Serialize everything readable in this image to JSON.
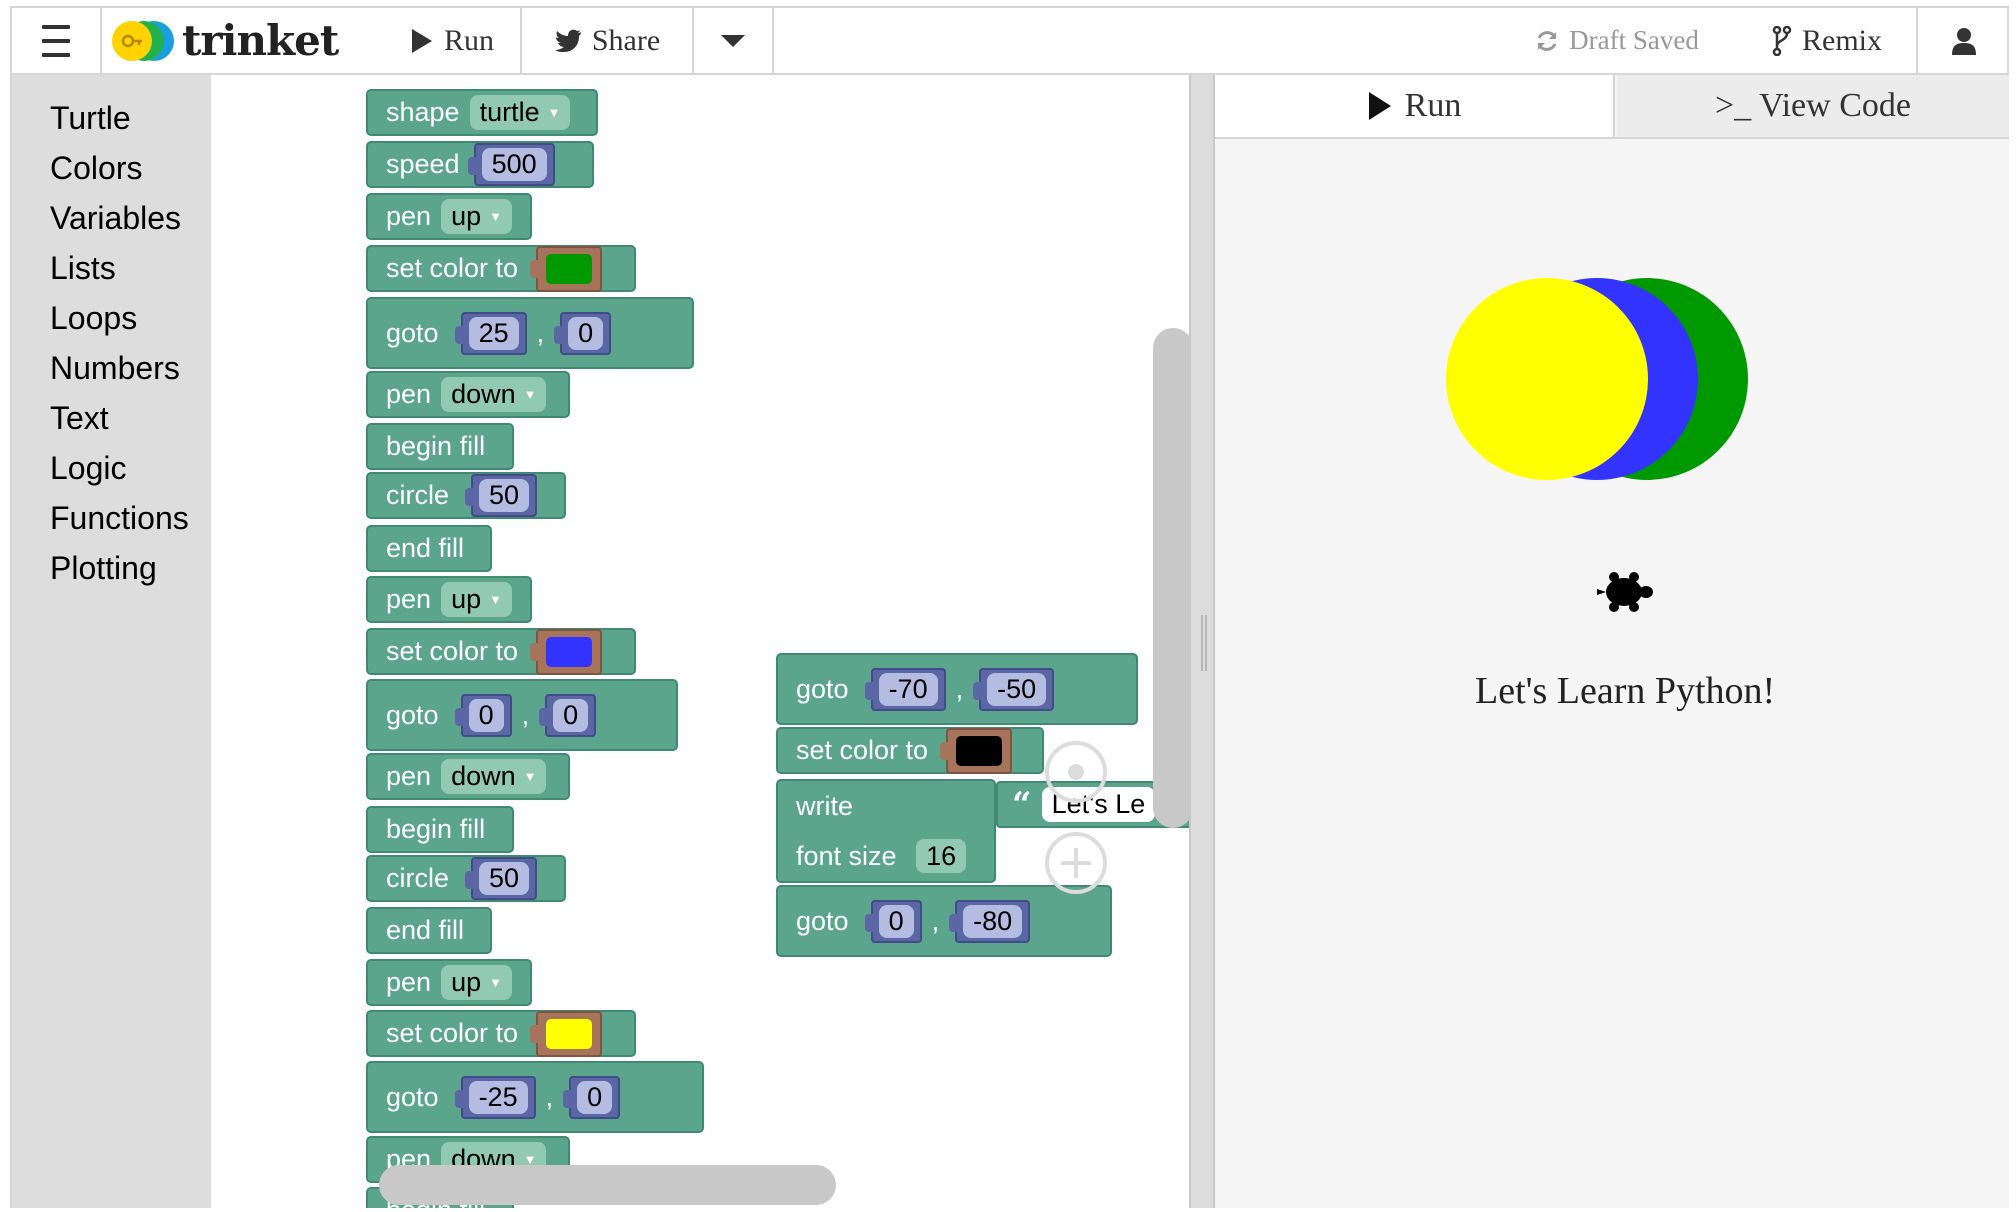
{
  "topbar": {
    "brand": "trinket",
    "run_label": "Run",
    "share_label": "Share",
    "status_label": "Draft Saved",
    "remix_label": "Remix"
  },
  "toolbox": {
    "categories": [
      "Turtle",
      "Colors",
      "Variables",
      "Lists",
      "Loops",
      "Numbers",
      "Text",
      "Logic",
      "Functions",
      "Plotting"
    ]
  },
  "blocks": {
    "shape_label": "shape",
    "shape_value": "turtle",
    "speed_label": "speed",
    "speed_value": "500",
    "pen_label": "pen",
    "up": "up",
    "down": "down",
    "set_color_label": "set color to",
    "goto_label": "goto",
    "comma": ",",
    "begin_fill_label": "begin fill",
    "circle_label": "circle",
    "circle_value": "50",
    "end_fill_label": "end fill",
    "goto1": [
      "25",
      "0"
    ],
    "goto2": [
      "0",
      "0"
    ],
    "goto3": [
      "-25",
      "0"
    ],
    "colors": [
      "#009900",
      "#3333ff",
      "#ffff00"
    ],
    "write_label": "write",
    "quote_mark": "“",
    "write_text": "Let's Le",
    "font_size_label": "font size",
    "font_size_value": "16",
    "goto4": [
      "-70",
      "-50"
    ],
    "goto5": [
      "0",
      "-80"
    ],
    "write_color": "#000000",
    "partial_begin": "begin fill"
  },
  "output": {
    "run_tab": "Run",
    "code_tab": ">_ View Code",
    "caption": "Let's Learn Python!",
    "circle_colors": [
      "#009900",
      "#3333ff",
      "#ffff00"
    ]
  }
}
